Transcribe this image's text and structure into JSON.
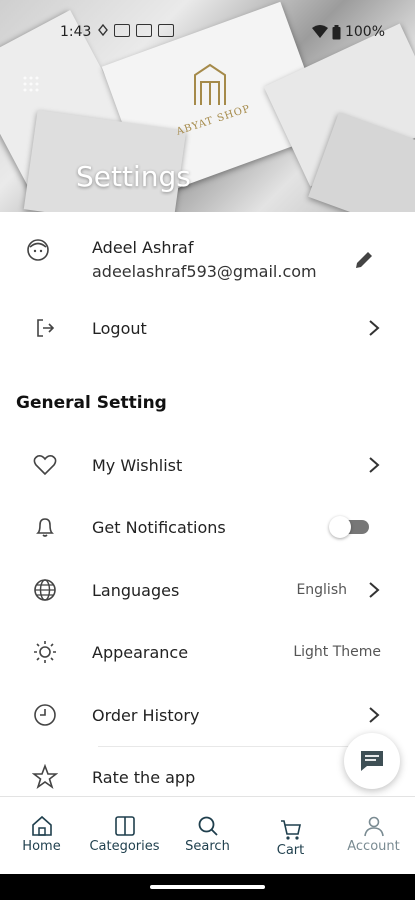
{
  "status_bar": {
    "time": "1:43",
    "battery": "100%"
  },
  "header": {
    "title": "Settings",
    "logo_text": "ABYAT SHOP"
  },
  "profile": {
    "name": "Adeel Ashraf",
    "email": "adeelashraf593@gmail.com"
  },
  "logout": {
    "label": "Logout"
  },
  "general_setting": {
    "title": "General Setting",
    "items": [
      {
        "label": "My Wishlist"
      },
      {
        "label": "Get Notifications",
        "toggle_on": false
      },
      {
        "label": "Languages",
        "value": "English"
      },
      {
        "label": "Appearance",
        "value": "Light Theme"
      },
      {
        "label": "Order History"
      },
      {
        "label": "Rate the app"
      }
    ]
  },
  "bottom_nav": {
    "items": [
      {
        "label": "Home"
      },
      {
        "label": "Categories"
      },
      {
        "label": "Search"
      },
      {
        "label": "Cart"
      },
      {
        "label": "Account"
      }
    ]
  }
}
